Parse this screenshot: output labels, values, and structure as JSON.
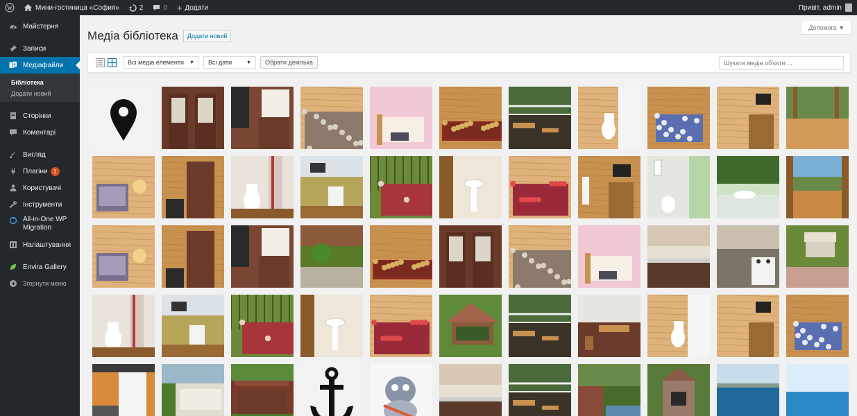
{
  "adminbar": {
    "site_name": "Мини-гостиница «София»",
    "updates_count": "2",
    "comments_count": "0",
    "new_label": "Додати",
    "greeting": "Привіт, admin"
  },
  "sidebar": {
    "items": [
      {
        "label": "Майстерня",
        "icon": "dashboard-icon"
      },
      {
        "label": "Записи",
        "icon": "pin-icon"
      },
      {
        "label": "Медіафайли",
        "icon": "media-icon"
      },
      {
        "label": "Сторінки",
        "icon": "pages-icon"
      },
      {
        "label": "Коментарі",
        "icon": "comments-icon"
      },
      {
        "label": "Вигляд",
        "icon": "appearance-icon"
      },
      {
        "label": "Плагіни",
        "icon": "plugins-icon",
        "badge": "1"
      },
      {
        "label": "Користувачі",
        "icon": "users-icon"
      },
      {
        "label": "Інструменти",
        "icon": "tools-icon"
      },
      {
        "label": "All-in-One WP Migration",
        "icon": "migration-icon"
      },
      {
        "label": "Налаштування",
        "icon": "settings-icon"
      },
      {
        "label": "Envira Gallery",
        "icon": "envira-leaf-icon"
      },
      {
        "label": "Згорнути меню",
        "icon": "collapse-icon"
      }
    ],
    "submenu": [
      {
        "label": "Бібліотека"
      },
      {
        "label": "Додати новий"
      }
    ]
  },
  "main": {
    "help_label": "Допомога ▼",
    "title": "Медіа бібліотека",
    "add_new_label": "Додати новий",
    "filter_type": "Всі медіа елементи",
    "filter_date": "Всі дати",
    "bulk_select_label": "Обрати декілька",
    "search_placeholder": "Шукати медіа об'єкти ..."
  },
  "media_items": [
    "map-pin-icon",
    "door",
    "door-window",
    "bed-floral",
    "pink-bed",
    "wood-bed",
    "veranda-table",
    "toilet-wood",
    "bed-blue",
    "tv-room",
    "veranda-floor",
    "armchair",
    "wardrobe",
    "toilet-curtain",
    "fridge-room",
    "bed-checkered",
    "sink",
    "bed-red",
    "tv-wall",
    "shower",
    "washbasin-green",
    "veranda-view",
    "armchair",
    "wardrobe",
    "door-window",
    "garden-path",
    "wood-bed",
    "door",
    "bed-floral",
    "pink-bed",
    "kitchen",
    "kitchen-stove",
    "garden-swing",
    "toilet-curtain",
    "fridge-room",
    "bed-checkered",
    "sink",
    "bed-red",
    "gazebo",
    "veranda-table",
    "veranda-chairs",
    "toilet-wood",
    "tv-room",
    "bed-blue",
    "kitchen-orange",
    "courtyard",
    "balcony",
    "anchor-icon",
    "cartoon-cat",
    "kitchen",
    "veranda-table",
    "garden-pool",
    "bbq-oven",
    "sea-bay",
    "sea"
  ]
}
